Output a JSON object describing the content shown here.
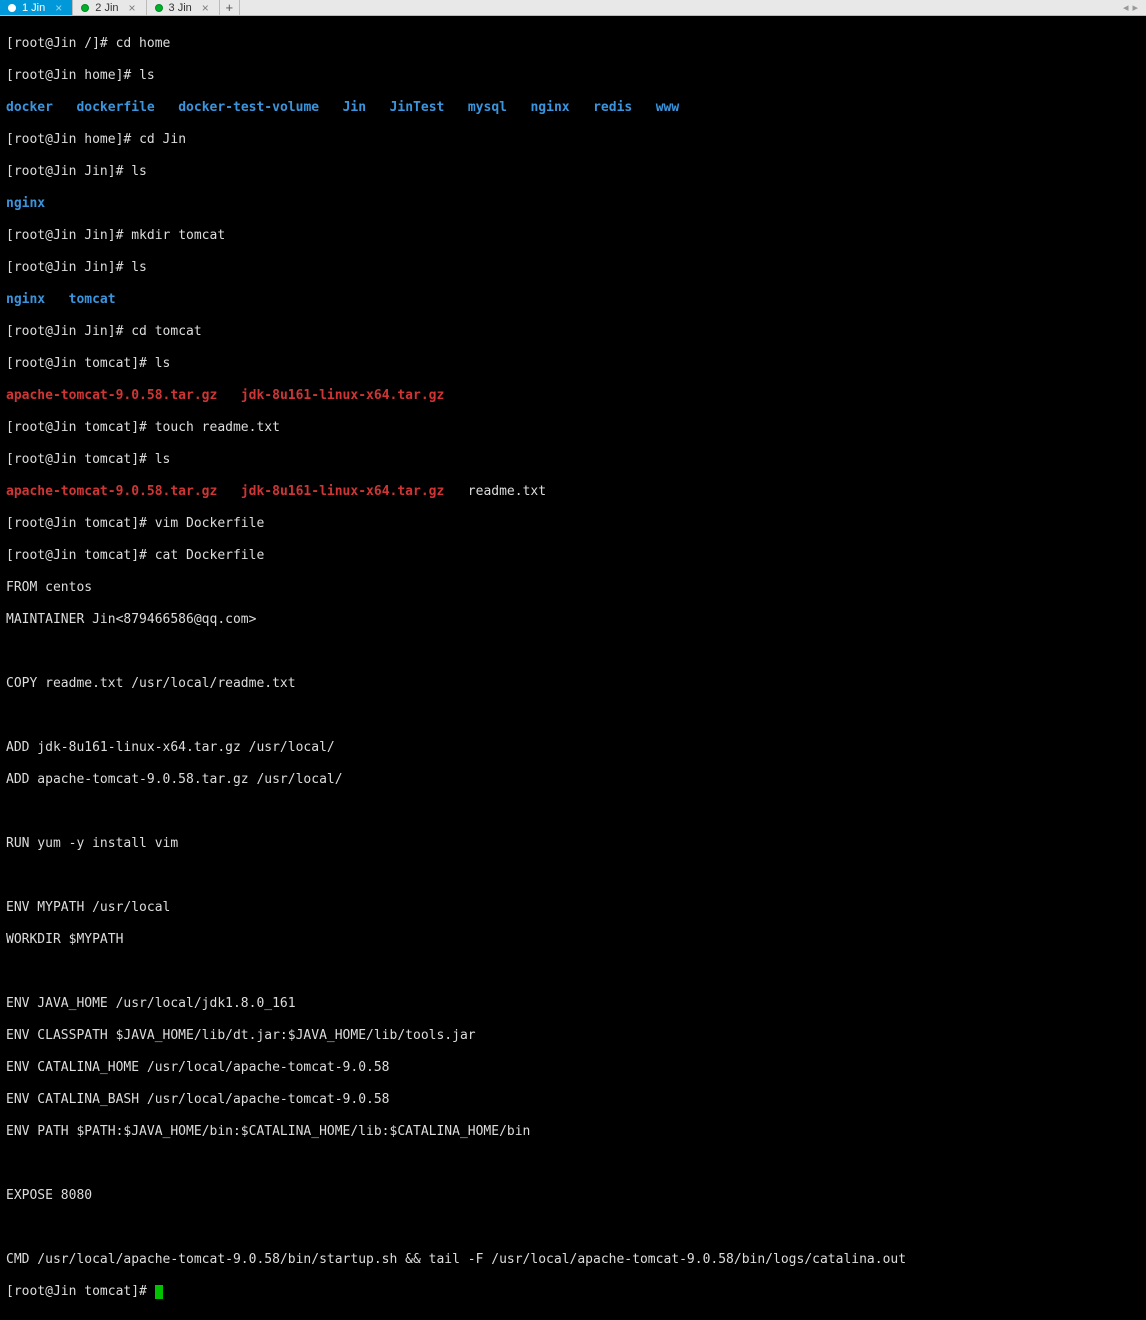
{
  "tabs": {
    "t1_label": "1 Jin",
    "t2_label": "2 Jin",
    "t3_label": "3 Jin",
    "new_label": "+",
    "arrow_left": "◂",
    "arrow_right": "▸"
  },
  "close_glyph": "×",
  "prompts": {
    "p_root": "[root@Jin /]# ",
    "p_home": "[root@Jin home]# ",
    "p_jin": "[root@Jin Jin]# ",
    "p_tomcat": "[root@Jin tomcat]# "
  },
  "cmds": {
    "cd_home": "cd home",
    "ls": "ls",
    "cd_Jin": "cd Jin",
    "mkdir_tomcat": "mkdir tomcat",
    "cd_tomcat": "cd tomcat",
    "touch_readme": "touch readme.txt",
    "vim_dockerfile": "vim Dockerfile",
    "cat_dockerfile": "cat Dockerfile"
  },
  "ls_home": {
    "a": "docker",
    "b": "dockerfile",
    "c": "docker-test-volume",
    "d": "Jin",
    "e": "JinTest",
    "f": "mysql",
    "g": "nginx",
    "h": "redis",
    "i": "www"
  },
  "ls_jin1": {
    "a": "nginx"
  },
  "ls_jin2": {
    "a": "nginx",
    "b": "tomcat"
  },
  "ls_tomcat1": {
    "a": "apache-tomcat-9.0.58.tar.gz",
    "b": "jdk-8u161-linux-x64.tar.gz"
  },
  "ls_tomcat2": {
    "a": "apache-tomcat-9.0.58.tar.gz",
    "b": "jdk-8u161-linux-x64.tar.gz",
    "c": "readme.txt"
  },
  "dockerfile": {
    "l1": "FROM centos",
    "l2": "MAINTAINER Jin<879466586@qq.com>",
    "l3": "",
    "l4": "COPY readme.txt /usr/local/readme.txt",
    "l5": "",
    "l6": "ADD jdk-8u161-linux-x64.tar.gz /usr/local/",
    "l7": "ADD apache-tomcat-9.0.58.tar.gz /usr/local/",
    "l8": "",
    "l9": "RUN yum -y install vim",
    "l10": "",
    "l11": "ENV MYPATH /usr/local",
    "l12": "WORKDIR $MYPATH",
    "l13": "",
    "l14": "ENV JAVA_HOME /usr/local/jdk1.8.0_161",
    "l15": "ENV CLASSPATH $JAVA_HOME/lib/dt.jar:$JAVA_HOME/lib/tools.jar",
    "l16": "ENV CATALINA_HOME /usr/local/apache-tomcat-9.0.58",
    "l17": "ENV CATALINA_BASH /usr/local/apache-tomcat-9.0.58",
    "l18": "ENV PATH $PATH:$JAVA_HOME/bin:$CATALINA_HOME/lib:$CATALINA_HOME/bin",
    "l19": "",
    "l20": "EXPOSE 8080",
    "l21": "",
    "l22": "CMD /usr/local/apache-tomcat-9.0.58/bin/startup.sh && tail -F /usr/local/apache-tomcat-9.0.58/bin/logs/catalina.out"
  }
}
